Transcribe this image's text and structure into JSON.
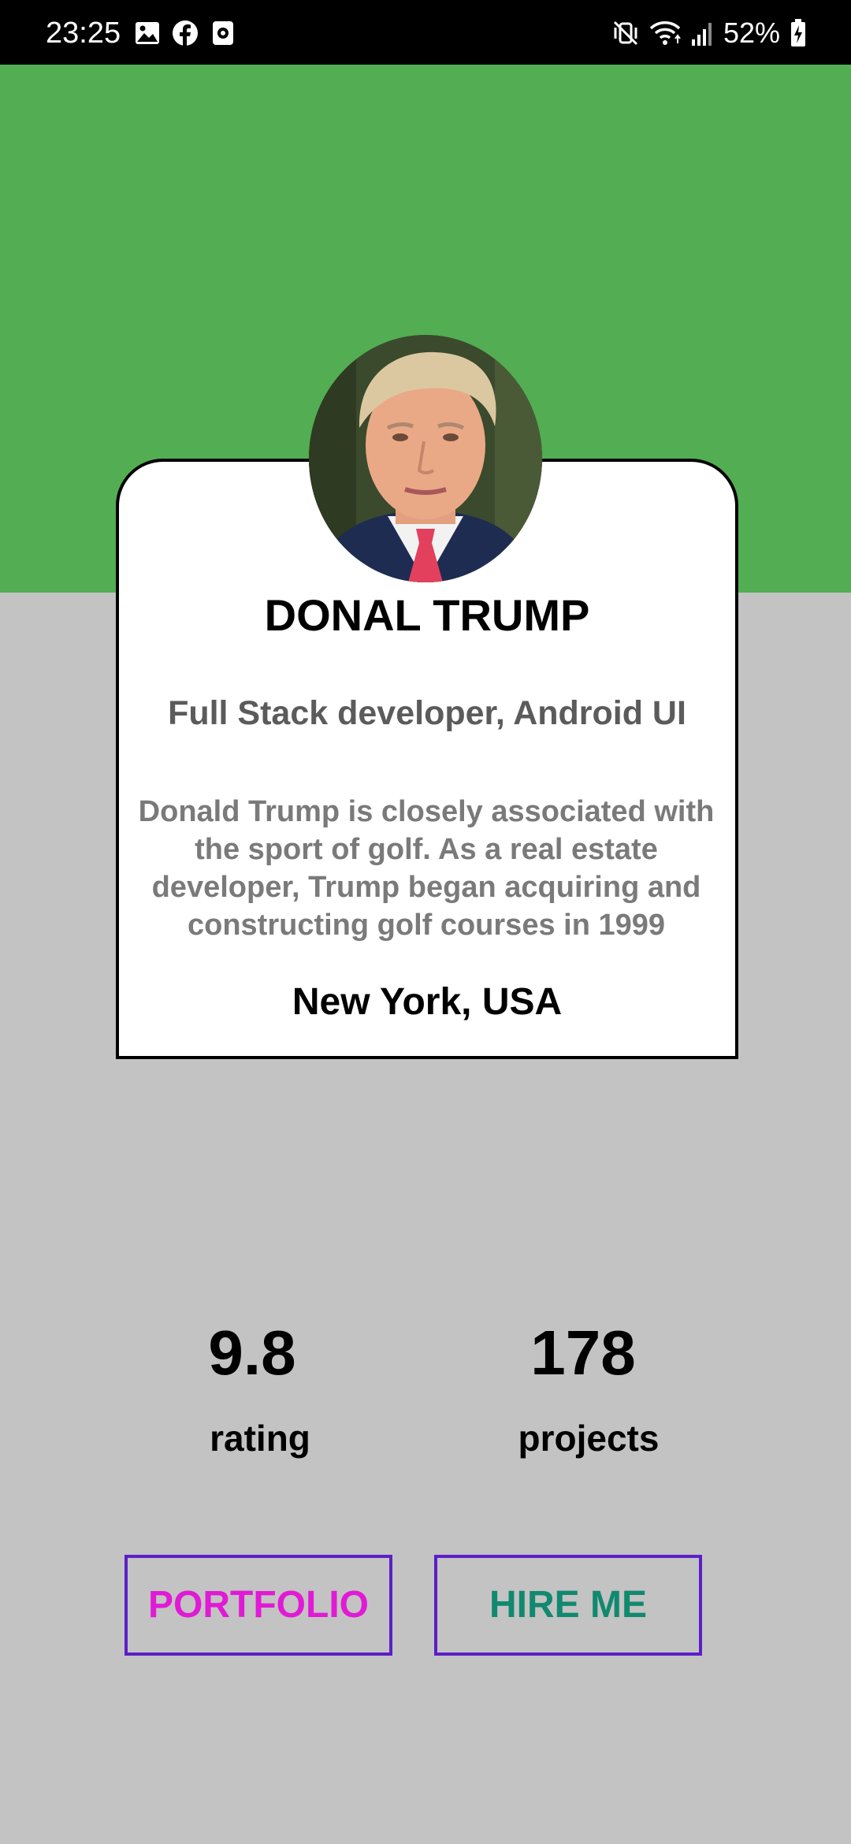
{
  "status_bar": {
    "time": "23:25",
    "left_icons": [
      "gallery-icon",
      "facebook-icon",
      "screen-record-icon"
    ],
    "right_icons": [
      "mute-vibrate-icon",
      "wifi-icon",
      "signal-icon",
      "battery-charging-icon"
    ],
    "battery": "52%"
  },
  "colors": {
    "header_bg": "#53ad53",
    "page_bg": "#c3c3c3",
    "portfolio_text": "#e11ad6",
    "hire_text": "#11896f",
    "button_border": "#5c1fc7"
  },
  "profile": {
    "avatar_icon": "profile-photo",
    "name": "DONAL TRUMP",
    "role": "Full Stack developer, Android UI",
    "bio": "Donald Trump is closely associated with the sport of golf. As a real estate developer, Trump began acquiring and constructing golf courses in 1999",
    "location": "New York, USA"
  },
  "stats": {
    "rating_value": "9.8",
    "rating_label": "rating",
    "projects_value": "178",
    "projects_label": "projects"
  },
  "actions": {
    "portfolio_label": "PORTFOLIO",
    "hire_label": "HIRE ME"
  }
}
